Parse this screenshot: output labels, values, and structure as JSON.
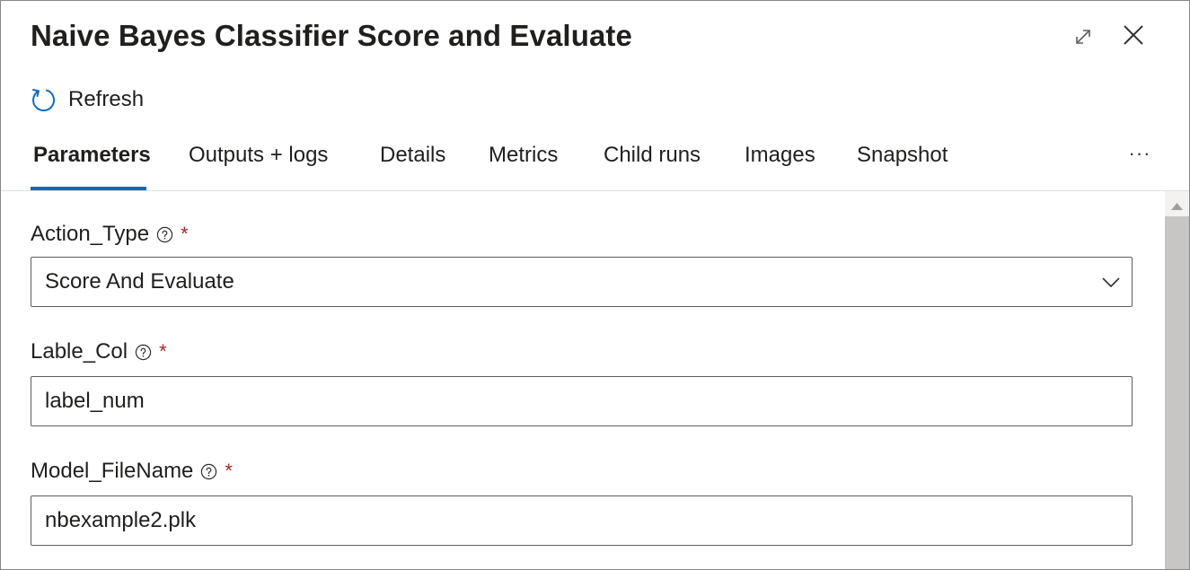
{
  "panel": {
    "title": "Naive Bayes Classifier Score and Evaluate"
  },
  "toolbar": {
    "refresh_label": "Refresh"
  },
  "tabs": [
    {
      "label": "Parameters",
      "active": true
    },
    {
      "label": "Outputs + logs",
      "active": false
    },
    {
      "label": "Details",
      "active": false
    },
    {
      "label": "Metrics",
      "active": false
    },
    {
      "label": "Child runs",
      "active": false
    },
    {
      "label": "Images",
      "active": false
    },
    {
      "label": "Snapshot",
      "active": false
    }
  ],
  "more_label": "···",
  "fields": {
    "action_type": {
      "label": "Action_Type",
      "required_mark": "*",
      "value": "Score And Evaluate"
    },
    "label_col": {
      "label": "Lable_Col",
      "required_mark": "*",
      "value": "label_num"
    },
    "model_filename": {
      "label": "Model_FileName",
      "required_mark": "*",
      "value": "nbexample2.plk"
    }
  },
  "icons": {
    "expand": "expand-icon",
    "close": "close-icon",
    "refresh": "refresh-icon",
    "help": "help-circle-icon",
    "chevron": "chevron-down-icon"
  },
  "colors": {
    "accent": "#0f6cbd",
    "required": "#a4262c",
    "text": "#201f1e",
    "border": "#605e5c"
  }
}
